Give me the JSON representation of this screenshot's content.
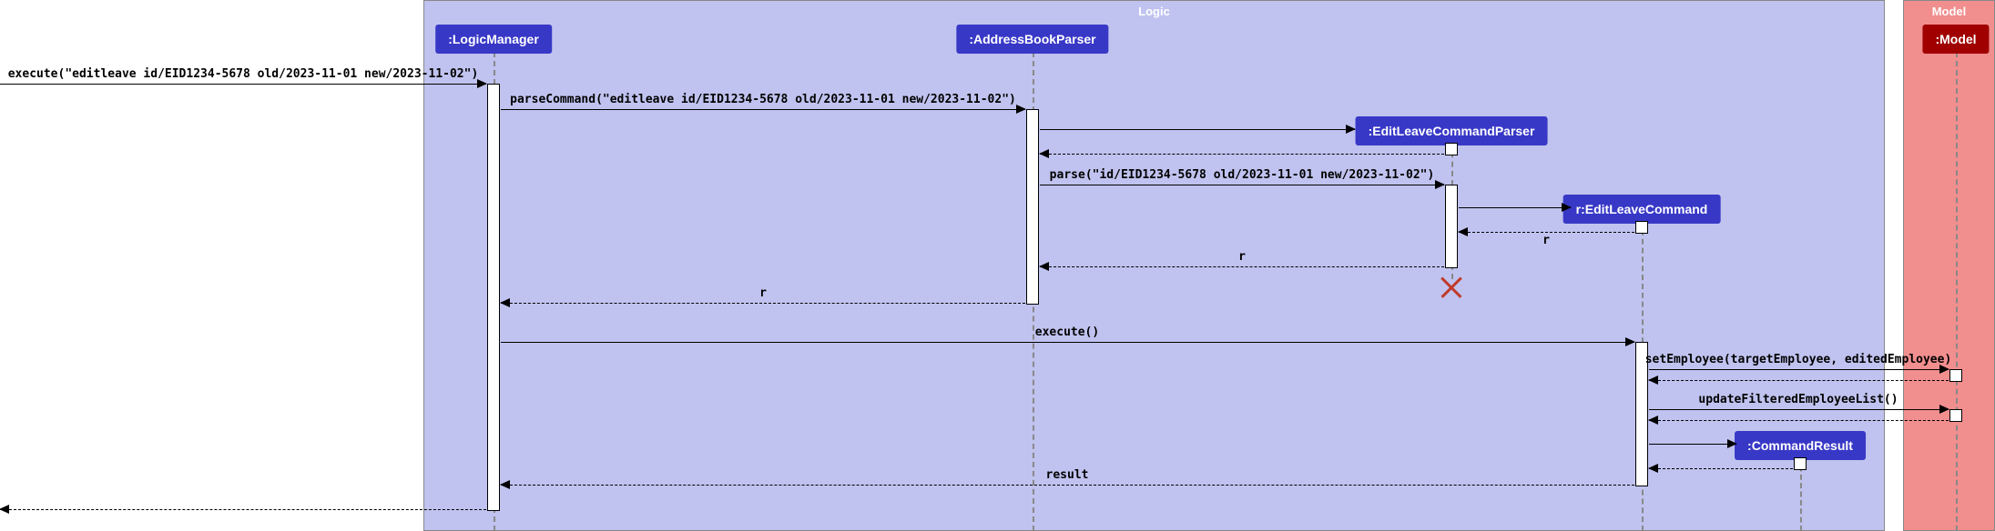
{
  "frames": {
    "logic": "Logic",
    "model": "Model"
  },
  "participants": {
    "logic_manager": ":LogicManager",
    "address_book_parser": ":AddressBookParser",
    "edit_leave_cmd_parser": ":EditLeaveCommandParser",
    "edit_leave_command": "r:EditLeaveCommand",
    "command_result": ":CommandResult",
    "model": ":Model"
  },
  "lifeline_x": {
    "logic_manager": 542,
    "address_book_parser": 1134,
    "edit_leave_cmd_parser": 1594,
    "edit_leave_command": 1803,
    "command_result": 1977,
    "model": 2148
  },
  "messages": {
    "m1": "execute(\"editleave id/EID1234-5678 old/2023-11-01 new/2023-11-02\")",
    "m2": "parseCommand(\"editleave id/EID1234-5678 old/2023-11-01 new/2023-11-02\")",
    "m3": "parse(\"id/EID1234-5678 old/2023-11-01 new/2023-11-02\")",
    "r1": "r",
    "r2": "r",
    "r3": "r",
    "m4": "execute()",
    "m5": "setEmployee(targetEmployee, editedEmployee)",
    "m6": "updateFilteredEmployeeList()",
    "r4": "result"
  },
  "chart_data": {
    "type": "sequence_diagram",
    "frames": [
      {
        "name": "Logic",
        "contains": [
          "LogicManager",
          "AddressBookParser",
          "EditLeaveCommandParser",
          "EditLeaveCommand",
          "CommandResult"
        ]
      },
      {
        "name": "Model",
        "contains": [
          "Model"
        ]
      }
    ],
    "participants": [
      {
        "id": "caller",
        "name": "",
        "external": true
      },
      {
        "id": "logic_manager",
        "name": ":LogicManager"
      },
      {
        "id": "address_book_parser",
        "name": ":AddressBookParser"
      },
      {
        "id": "edit_leave_cmd_parser",
        "name": ":EditLeaveCommandParser",
        "created_during_sequence": true
      },
      {
        "id": "edit_leave_command",
        "name": "r:EditLeaveCommand",
        "created_during_sequence": true
      },
      {
        "id": "command_result",
        "name": ":CommandResult",
        "created_during_sequence": true
      },
      {
        "id": "model",
        "name": ":Model"
      }
    ],
    "messages": [
      {
        "from": "caller",
        "to": "logic_manager",
        "type": "call",
        "label": "execute(\"editleave id/EID1234-5678 old/2023-11-01 new/2023-11-02\")"
      },
      {
        "from": "logic_manager",
        "to": "address_book_parser",
        "type": "call",
        "label": "parseCommand(\"editleave id/EID1234-5678 old/2023-11-01 new/2023-11-02\")"
      },
      {
        "from": "address_book_parser",
        "to": "edit_leave_cmd_parser",
        "type": "create",
        "label": ""
      },
      {
        "from": "edit_leave_cmd_parser",
        "to": "address_book_parser",
        "type": "return",
        "label": ""
      },
      {
        "from": "address_book_parser",
        "to": "edit_leave_cmd_parser",
        "type": "call",
        "label": "parse(\"id/EID1234-5678 old/2023-11-01 new/2023-11-02\")"
      },
      {
        "from": "edit_leave_cmd_parser",
        "to": "edit_leave_command",
        "type": "create",
        "label": ""
      },
      {
        "from": "edit_leave_command",
        "to": "edit_leave_cmd_parser",
        "type": "return",
        "label": "r"
      },
      {
        "from": "edit_leave_cmd_parser",
        "to": "address_book_parser",
        "type": "return",
        "label": "r"
      },
      {
        "from": "edit_leave_cmd_parser",
        "to": null,
        "type": "destroy",
        "label": ""
      },
      {
        "from": "address_book_parser",
        "to": "logic_manager",
        "type": "return",
        "label": "r"
      },
      {
        "from": "logic_manager",
        "to": "edit_leave_command",
        "type": "call",
        "label": "execute()"
      },
      {
        "from": "edit_leave_command",
        "to": "model",
        "type": "call",
        "label": "setEmployee(targetEmployee, editedEmployee)"
      },
      {
        "from": "model",
        "to": "edit_leave_command",
        "type": "return",
        "label": ""
      },
      {
        "from": "edit_leave_command",
        "to": "model",
        "type": "call",
        "label": "updateFilteredEmployeeList()"
      },
      {
        "from": "model",
        "to": "edit_leave_command",
        "type": "return",
        "label": ""
      },
      {
        "from": "edit_leave_command",
        "to": "command_result",
        "type": "create",
        "label": ""
      },
      {
        "from": "command_result",
        "to": "edit_leave_command",
        "type": "return",
        "label": ""
      },
      {
        "from": "edit_leave_command",
        "to": "logic_manager",
        "type": "return",
        "label": "result"
      },
      {
        "from": "logic_manager",
        "to": "caller",
        "type": "return",
        "label": ""
      }
    ]
  }
}
